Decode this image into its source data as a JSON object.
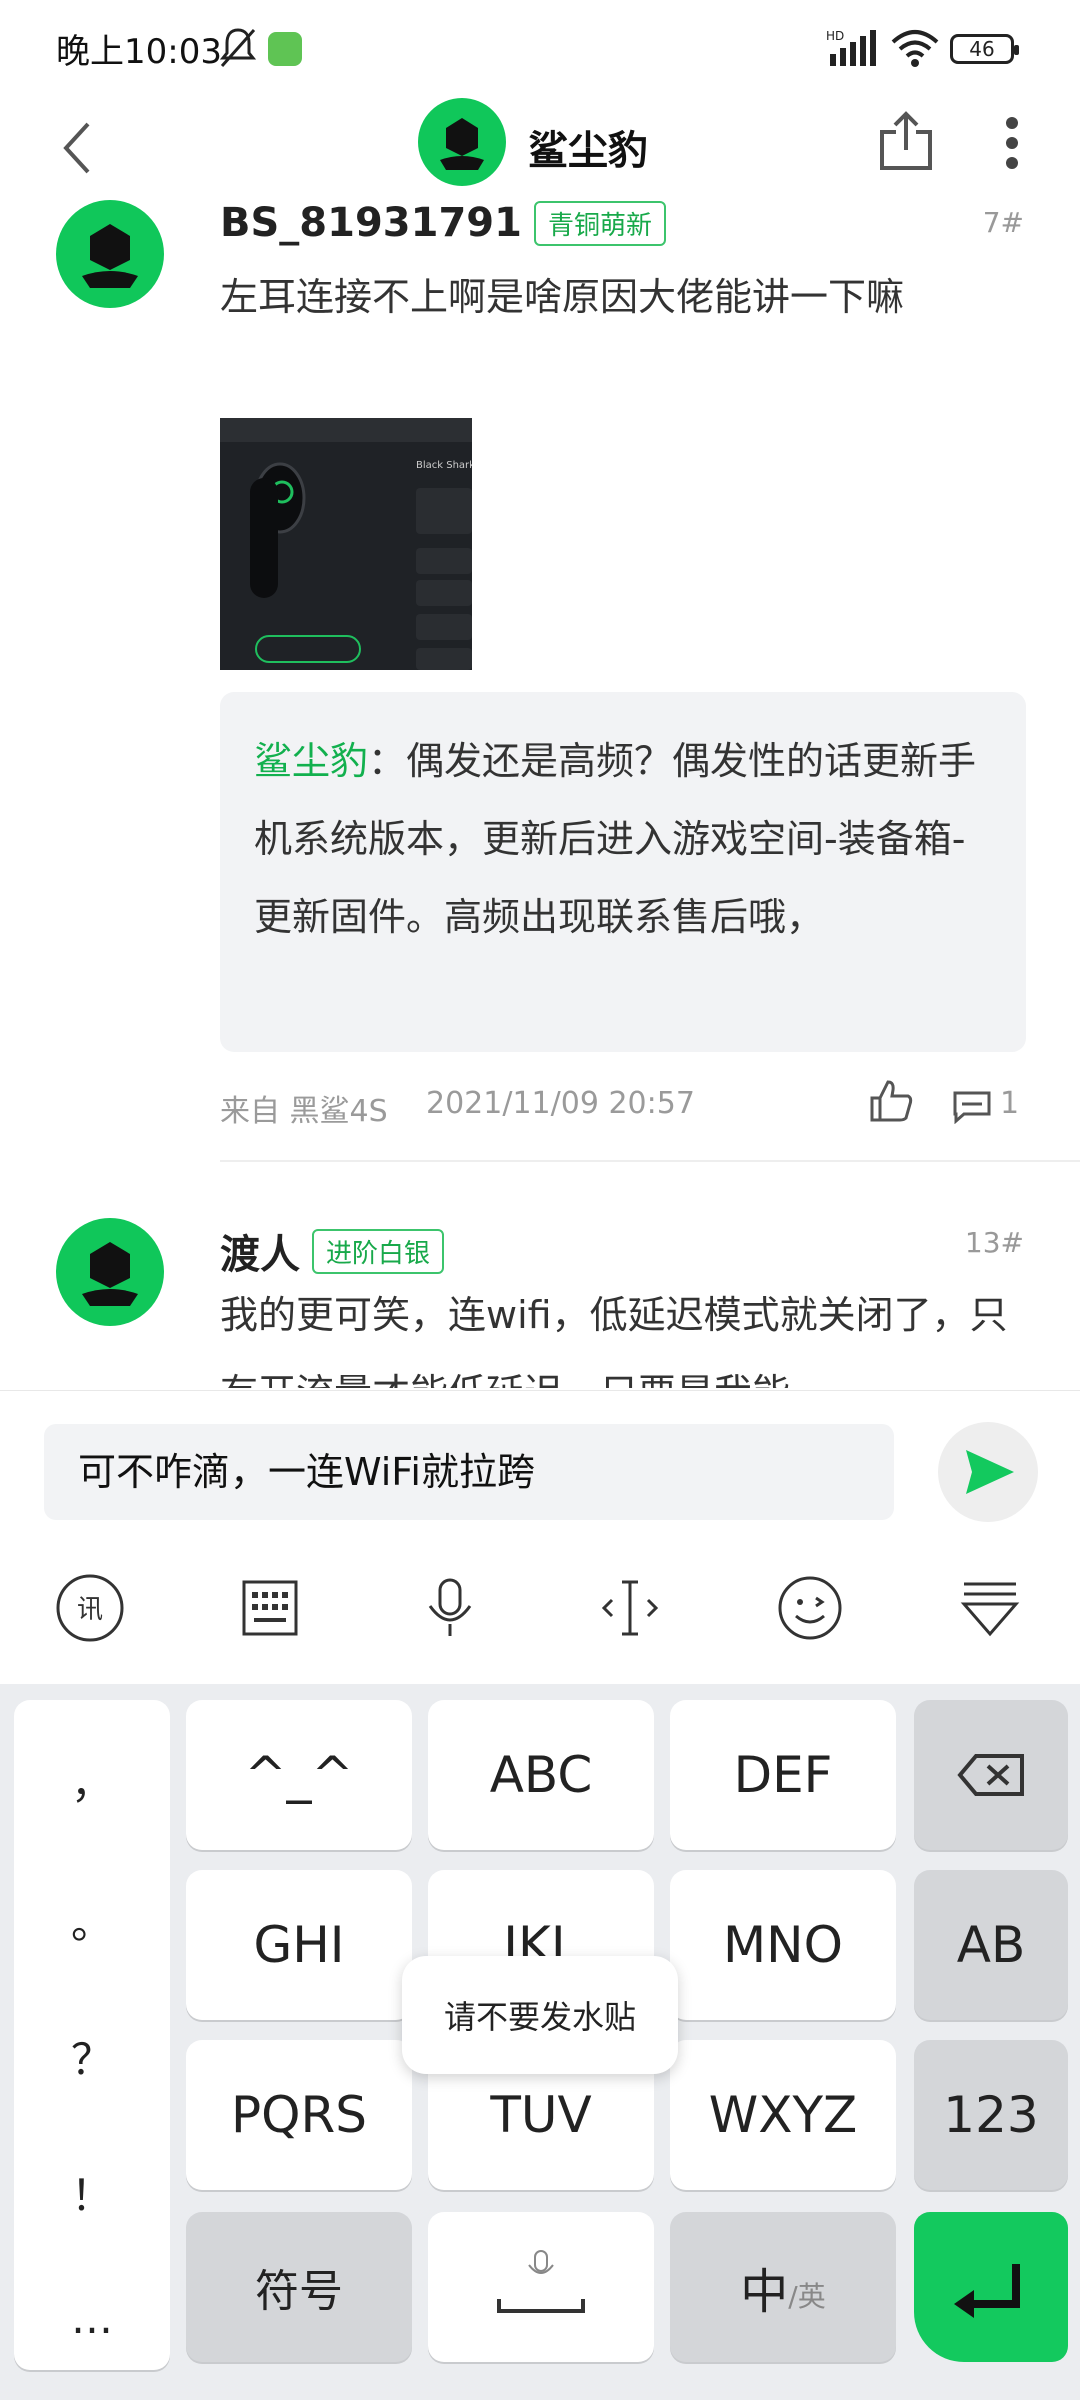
{
  "status": {
    "time": "晚上10:03",
    "battery": "46",
    "signal_label": "HD"
  },
  "header": {
    "title": "鲨尘豹"
  },
  "posts": [
    {
      "username": "BS_81931791",
      "rank": "青铜萌新",
      "floor": "7#",
      "content": "左耳连接不上啊是啥原因大佬能讲一下嘛",
      "image_caption": "Black Shark",
      "reply": {
        "author": "鲨尘豹",
        "sep": "：",
        "text": "偶发还是高频？偶发性的话更新手机系统版本，更新后进入游戏空间-装备箱-更新固件。高频出现联系售后哦，"
      },
      "source": "来自 黑鲨4S",
      "datetime": "2021/11/09 20:57",
      "comments": "1"
    },
    {
      "username": "渡人",
      "rank": "进阶白银",
      "floor": "13#",
      "content": "我的更可笑，连wifi，低延迟模式就关闭了，只有开流量才能低延迟，只要是我能"
    }
  ],
  "compose": {
    "input_value": "可不咋滴，一连WiFi就拉跨"
  },
  "ime_toolbar": [
    "xunfei-icon",
    "keyboard-icon",
    "mic-icon",
    "cursor-icon",
    "emoji-icon",
    "collapse-icon"
  ],
  "keyboard": {
    "punctuation": [
      "，",
      "。",
      "？",
      "！",
      "…"
    ],
    "row1": [
      "^_^",
      "ABC",
      "DEF"
    ],
    "row2": [
      "GHI",
      "JKL",
      "MNO"
    ],
    "row2_side": "AB",
    "row3": [
      "PQRS",
      "TUV",
      "WXYZ"
    ],
    "row3_side": "123",
    "symbol": "符号",
    "lang_main": "中",
    "lang_sub": "/英",
    "tooltip": "请不要发水贴"
  },
  "colors": {
    "accent": "#13c95e",
    "rank_green": "#18a94a"
  }
}
